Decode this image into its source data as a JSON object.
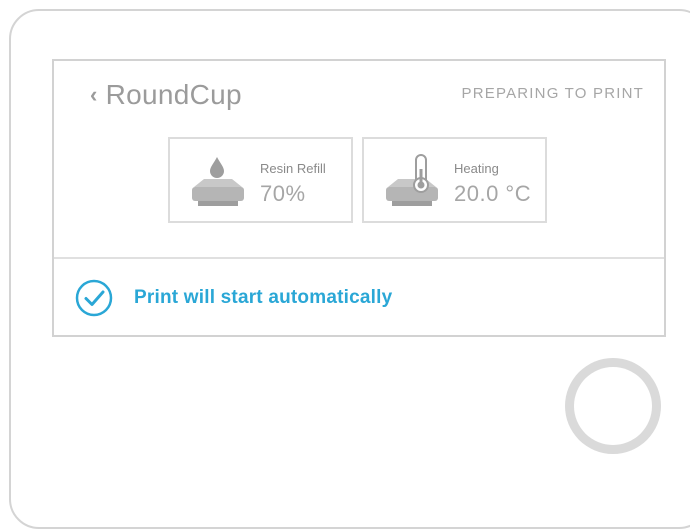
{
  "header": {
    "back_icon": "chevron-left-icon",
    "title": "RoundCup",
    "status": "PREPARING TO PRINT"
  },
  "cards": {
    "resin": {
      "icon": "resin-tank-icon",
      "label": "Resin Refill",
      "value": "70%"
    },
    "heating": {
      "icon": "thermometer-tank-icon",
      "label": "Heating",
      "value": "20.0 °C"
    }
  },
  "footer": {
    "icon": "check-circle-icon",
    "message": "Print will start automatically"
  },
  "colors": {
    "accent": "#2aa7d6",
    "muted_text": "#9b9b9b",
    "border": "#d2d2d2"
  }
}
